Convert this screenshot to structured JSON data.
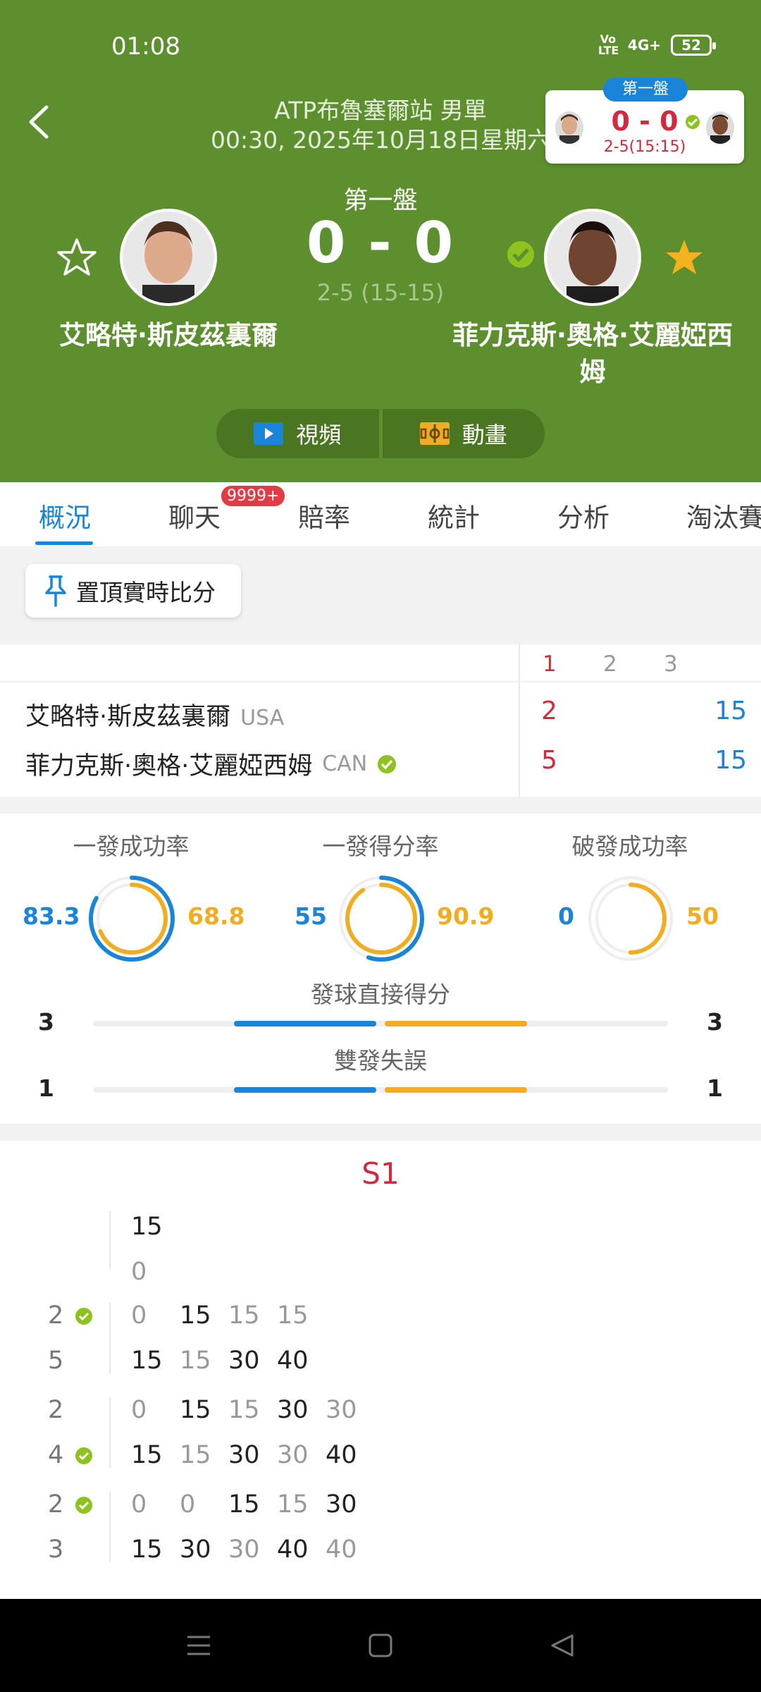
{
  "status_bar": {
    "time": "01:08",
    "volte": "Vo LTE",
    "network": "4G+",
    "battery": "52"
  },
  "header": {
    "tournament": "ATP布魯塞爾站 男單",
    "datetime": "00:30, 2025年10月18日星期六",
    "set_label": "第一盤",
    "score": "0 - 0",
    "sub_score": "2-5 (15-15)"
  },
  "mini_score": {
    "set": "第一盤",
    "score": "0 - 0",
    "sub": "2-5(15:15)"
  },
  "players": {
    "p1": {
      "name": "艾略特·斯皮茲裏爾",
      "country": "USA"
    },
    "p2": {
      "name_line1": "菲力克斯·奧格·艾麗婭西",
      "name_line2": "姆",
      "name": "菲力克斯·奧格·艾麗婭西姆",
      "country": "CAN"
    }
  },
  "media": {
    "video": "視頻",
    "animation": "動畫"
  },
  "tabs": [
    {
      "label": "概況"
    },
    {
      "label": "聊天"
    },
    {
      "label": "賠率"
    },
    {
      "label": "統計"
    },
    {
      "label": "分析"
    },
    {
      "label": "淘汰賽"
    }
  ],
  "chat_badge": "9999+",
  "pin_button": "置頂實時比分",
  "scoreboard": {
    "set_headers": [
      "1",
      "2",
      "3"
    ],
    "rows": [
      {
        "games": "2",
        "points": "15"
      },
      {
        "games": "5",
        "points": "15"
      }
    ]
  },
  "stats": {
    "rings": [
      {
        "title": "一發成功率",
        "left": "83.3",
        "right": "68.8",
        "left_pct": 83.3,
        "right_pct": 68.8
      },
      {
        "title": "一發得分率",
        "left": "55",
        "right": "90.9",
        "left_pct": 55,
        "right_pct": 90.9
      },
      {
        "title": "破發成功率",
        "left": "0",
        "right": "50",
        "left_pct": 0,
        "right_pct": 50
      }
    ],
    "bars": [
      {
        "title": "發球直接得分",
        "left": "3",
        "right": "3"
      },
      {
        "title": "雙發失誤",
        "left": "1",
        "right": "1"
      }
    ]
  },
  "pbp": {
    "title": "S1",
    "first": {
      "top": "15",
      "bottom": "0"
    },
    "games": [
      {
        "score_top": "2",
        "score_bottom": "5",
        "server": "top",
        "top": [
          "0",
          "15",
          "15",
          "15"
        ],
        "bottom": [
          "15",
          "15",
          "30",
          "40"
        ],
        "top_dim": [
          true,
          false,
          true,
          true
        ],
        "bottom_dim": [
          false,
          true,
          false,
          false
        ]
      },
      {
        "score_top": "2",
        "score_bottom": "4",
        "server": "bottom",
        "top": [
          "0",
          "15",
          "15",
          "30",
          "30"
        ],
        "bottom": [
          "15",
          "15",
          "30",
          "30",
          "40"
        ],
        "top_dim": [
          true,
          false,
          true,
          false,
          true
        ],
        "bottom_dim": [
          false,
          true,
          false,
          true,
          false
        ]
      },
      {
        "score_top": "2",
        "score_bottom": "3",
        "server": "top",
        "top": [
          "0",
          "0",
          "15",
          "15",
          "30"
        ],
        "bottom": [
          "15",
          "30",
          "30",
          "40",
          "40"
        ],
        "top_dim": [
          true,
          true,
          false,
          true,
          false
        ],
        "bottom_dim": [
          false,
          false,
          true,
          false,
          true
        ]
      }
    ]
  },
  "colors": {
    "header_green": "#5d8f2e",
    "accent_blue": "#1a84d8",
    "accent_gold": "#f0ad22",
    "red": "#d12a3f"
  }
}
